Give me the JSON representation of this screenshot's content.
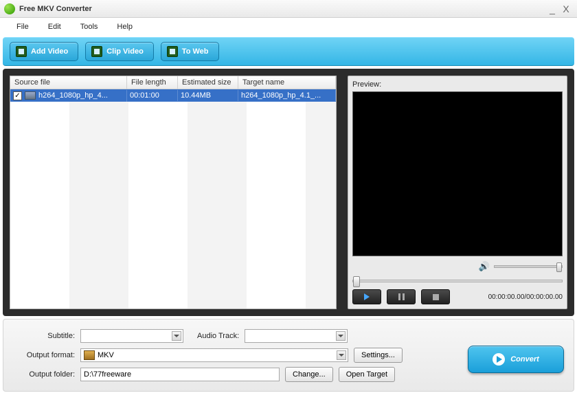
{
  "window": {
    "title": "Free MKV Converter"
  },
  "menu": {
    "file": "File",
    "edit": "Edit",
    "tools": "Tools",
    "help": "Help"
  },
  "toolbar": {
    "add_video": "Add Video",
    "clip_video": "Clip Video",
    "to_web": "To Web"
  },
  "table": {
    "headers": {
      "source": "Source file",
      "length": "File length",
      "size": "Estimated size",
      "target": "Target name"
    },
    "rows": [
      {
        "checked": true,
        "source": "h264_1080p_hp_4...",
        "length": "00:01:00",
        "size": "10.44MB",
        "target": "h264_1080p_hp_4.1_..."
      }
    ]
  },
  "preview": {
    "label": "Preview:",
    "timecode": "00:00:00.00/00:00:00.00"
  },
  "bottom": {
    "subtitle_label": "Subtitle:",
    "subtitle_value": "",
    "audiotrack_label": "Audio Track:",
    "audiotrack_value": "",
    "output_format_label": "Output format:",
    "output_format_value": "MKV",
    "settings": "Settings...",
    "output_folder_label": "Output folder:",
    "output_folder_value": "D:\\77freeware",
    "change": "Change...",
    "open_target": "Open Target",
    "convert": "Convert"
  }
}
